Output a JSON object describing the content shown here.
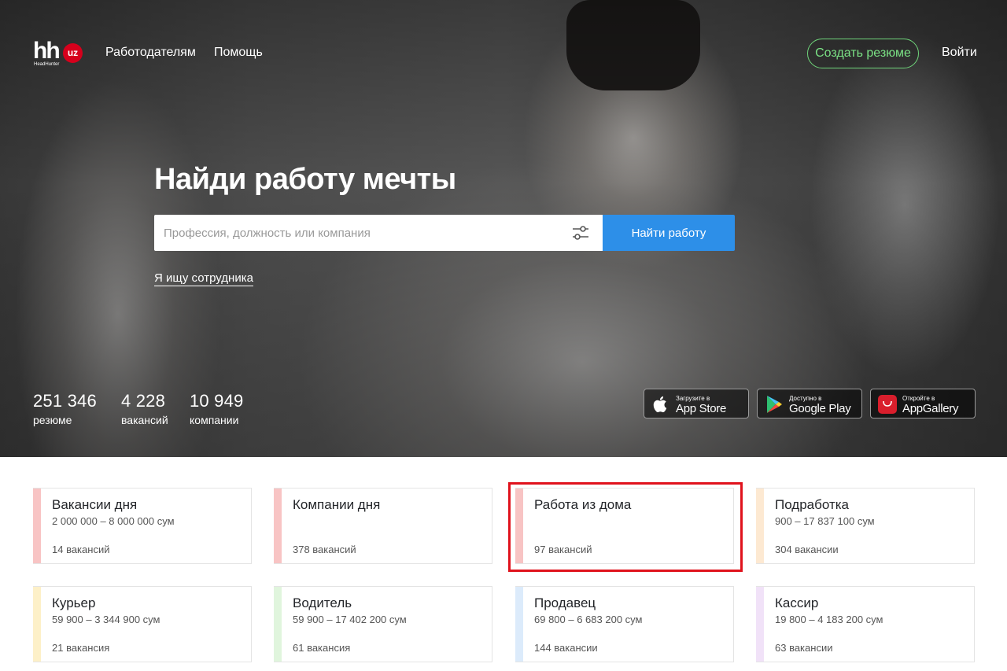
{
  "header": {
    "logo_text": "hh",
    "logo_badge": "uz",
    "logo_sub": "HeadHunter",
    "nav": [
      "Работодателям",
      "Помощь"
    ],
    "create_resume": "Создать резюме",
    "login": "Войти"
  },
  "hero": {
    "title": "Найди работу мечты",
    "search_placeholder": "Профессия, должность или компания",
    "search_button": "Найти работу",
    "employer_link": "Я ищу сотрудника"
  },
  "stats": [
    {
      "value": "251 346",
      "label": "резюме"
    },
    {
      "value": "4 228",
      "label": "вакансий"
    },
    {
      "value": "10 949",
      "label": "компании"
    }
  ],
  "stores": [
    {
      "small": "Загрузите в",
      "big": "App Store",
      "icon": "apple-icon"
    },
    {
      "small": "Доступно в",
      "big": "Google Play",
      "icon": "google-play-icon"
    },
    {
      "small": "Откройте в",
      "big": "AppGallery",
      "icon": "huawei-icon"
    }
  ],
  "cards": [
    {
      "title": "Вакансии дня",
      "salary": "2 000 000 – 8 000 000 сум",
      "count": "14 вакансий",
      "color": "#f8c4c4"
    },
    {
      "title": "Компании дня",
      "salary": "",
      "count": "378 вакансий",
      "color": "#f8c4c4"
    },
    {
      "title": "Работа из дома",
      "salary": "",
      "count": "97 вакансий",
      "color": "#f8c4c4"
    },
    {
      "title": "Подработка",
      "salary": "900 – 17 837 100 сум",
      "count": "304 вакансии",
      "color": "#fde9d2"
    },
    {
      "title": "Курьер",
      "salary": "59 900 – 3 344 900 сум",
      "count": "21 вакансия",
      "color": "#fdf0c8"
    },
    {
      "title": "Водитель",
      "salary": "59 900 – 17 402 200 сум",
      "count": "61 вакансия",
      "color": "#e0f5dd"
    },
    {
      "title": "Продавец",
      "salary": "69 800 – 6 683 200 сум",
      "count": "144 вакансии",
      "color": "#dcebfb"
    },
    {
      "title": "Кассир",
      "salary": "19 800 – 4 183 200 сум",
      "count": "63 вакансии",
      "color": "#f1e2f8"
    }
  ],
  "colors": {
    "accent_blue": "#2d8fe8",
    "accent_green": "#7be285",
    "brand_red": "#d6001c",
    "highlight_red": "#e0121c"
  }
}
